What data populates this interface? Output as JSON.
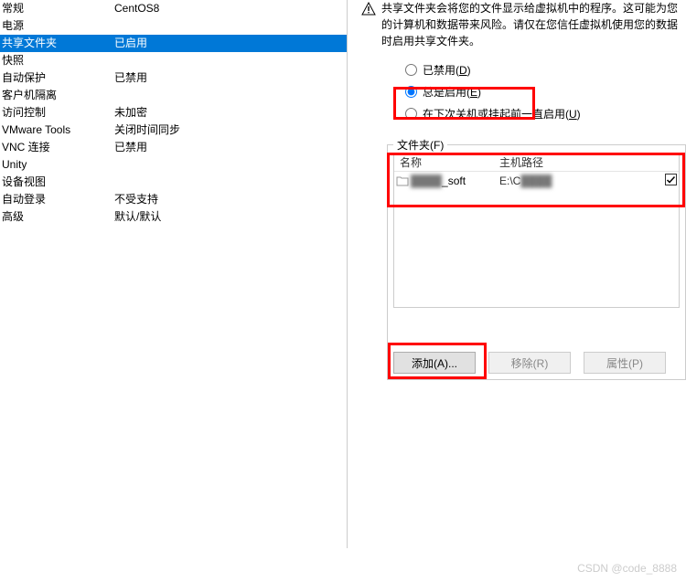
{
  "sidebar": {
    "items": [
      {
        "label": "常规",
        "value": "CentOS8"
      },
      {
        "label": "电源",
        "value": ""
      },
      {
        "label": "共享文件夹",
        "value": "已启用"
      },
      {
        "label": "快照",
        "value": ""
      },
      {
        "label": "自动保护",
        "value": "已禁用"
      },
      {
        "label": "客户机隔离",
        "value": ""
      },
      {
        "label": "访问控制",
        "value": "未加密"
      },
      {
        "label": "VMware Tools",
        "value": "关闭时间同步"
      },
      {
        "label": "VNC 连接",
        "value": "已禁用"
      },
      {
        "label": "Unity",
        "value": ""
      },
      {
        "label": "设备视图",
        "value": ""
      },
      {
        "label": "自动登录",
        "value": "不受支持"
      },
      {
        "label": "高级",
        "value": "默认/默认"
      }
    ],
    "selected_index": 2
  },
  "warning_text": "共享文件夹会将您的文件显示给虚拟机中的程序。这可能为您的计算机和数据带来风险。请仅在您信任虚拟机使用您的数据时启用共享文件夹。",
  "radios": {
    "disabled": {
      "text": "已禁用(",
      "hotkey": "D",
      "suffix": ")"
    },
    "always": {
      "text": "总是启用(",
      "hotkey": "E",
      "suffix": ")"
    },
    "until": {
      "text": "在下次关机或挂起前一直启用(",
      "hotkey": "U",
      "suffix": ")"
    },
    "selected": "always"
  },
  "folders": {
    "legend": "文件夹(",
    "legend_hotkey": "F",
    "legend_suffix": ")",
    "columns": {
      "name": "名称",
      "host": "主机路径"
    },
    "rows": [
      {
        "name_prefix": "",
        "name_blur": "████",
        "name_suffix": "_soft",
        "host": "E:\\C",
        "host_blur": "████",
        "checked": true
      }
    ]
  },
  "buttons": {
    "add": {
      "text": "添加(",
      "hotkey": "A",
      "suffix": ")..."
    },
    "remove": {
      "text": "移除(",
      "hotkey": "R",
      "suffix": ")"
    },
    "props": {
      "text": "属性(",
      "hotkey": "P",
      "suffix": ")"
    }
  },
  "watermark": "CSDN @code_8888"
}
